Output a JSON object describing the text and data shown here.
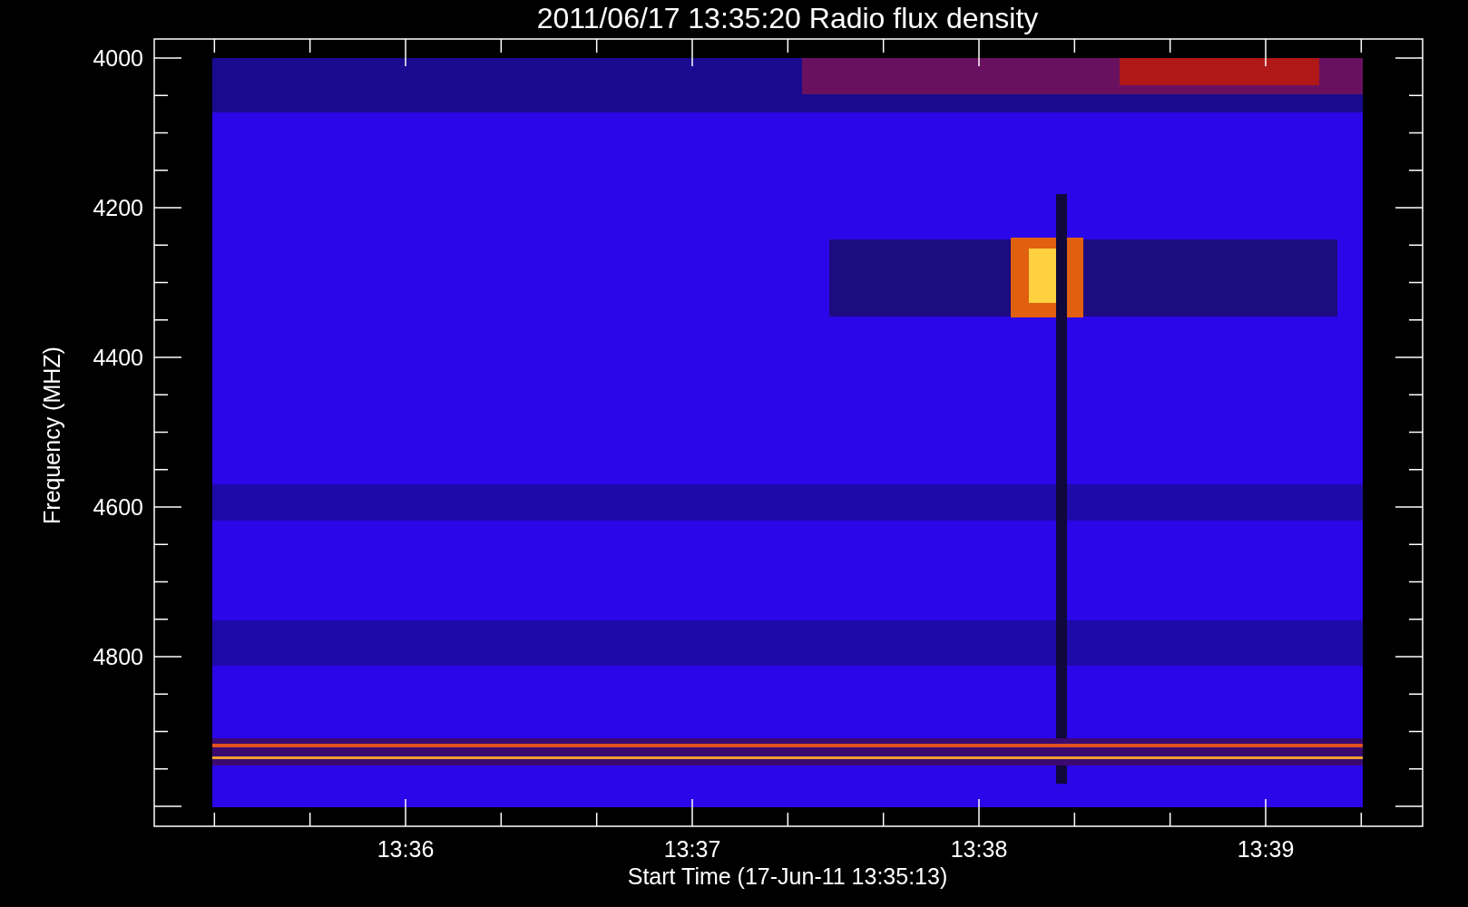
{
  "title": "2011/06/17 13:35:20 Radio flux density",
  "y_axis": {
    "label": "Frequency (MHZ)",
    "ticks": [
      "4000",
      "4200",
      "4400",
      "4600",
      "4800"
    ]
  },
  "x_axis": {
    "label": "Start Time (17-Jun-11 13:35:13)",
    "ticks": [
      "13:36",
      "13:37",
      "13:38",
      "13:39"
    ]
  }
}
